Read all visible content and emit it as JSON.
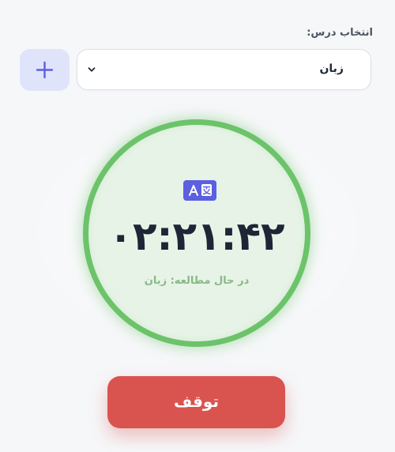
{
  "subject_picker": {
    "label": "انتخاب درس:",
    "selected": "زبان"
  },
  "timer": {
    "time": "۰۲:۲۱:۴۲",
    "status": "در حال مطالعه: زبان",
    "subject_icon": "translate-icon"
  },
  "actions": {
    "stop_label": "توقف",
    "add_icon": "plus-icon"
  },
  "colors": {
    "ring": "#6cc36a",
    "stop": "#d9534f",
    "accent": "#5b5fe0"
  }
}
